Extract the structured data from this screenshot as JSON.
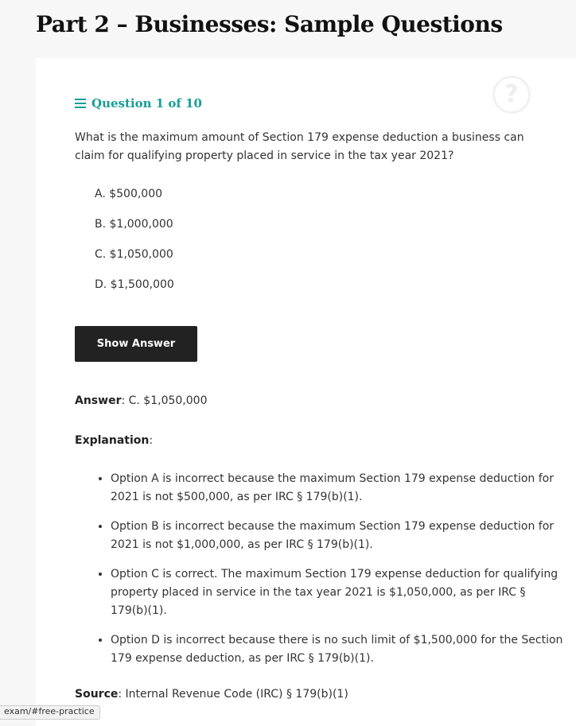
{
  "page_title": "Part 2 – Businesses: Sample Questions",
  "question": {
    "counter": "Question 1 of 10",
    "text": "What is the maximum amount of Section 179 expense deduction a business can claim for qualifying property placed in service in the tax year 2021?",
    "options": [
      "A. $500,000",
      "B. $1,000,000",
      "C. $1,050,000",
      "D. $1,500,000"
    ],
    "help_icon": "?"
  },
  "show_answer_label": "Show Answer",
  "answer": {
    "label": "Answer",
    "value": ": C. $1,050,000"
  },
  "explanation": {
    "label": "Explanation",
    "suffix": ":",
    "items": [
      "Option A is incorrect because the maximum Section 179 expense deduction for 2021 is not $500,000, as per IRC § 179(b)(1).",
      "Option B is incorrect because the maximum Section 179 expense deduction for 2021 is not $1,000,000, as per IRC § 179(b)(1).",
      "Option C is correct. The maximum Section 179 expense deduction for qualifying property placed in service in the tax year 2021 is $1,050,000, as per IRC § 179(b)(1).",
      "Option D is incorrect because there is no such limit of $1,500,000 for the Section 179 expense deduction, as per IRC § 179(b)(1)."
    ]
  },
  "source": {
    "label": "Source",
    "value": ": Internal Revenue Code (IRC) § 179(b)(1)"
  },
  "status_url": "exam/#free-practice"
}
